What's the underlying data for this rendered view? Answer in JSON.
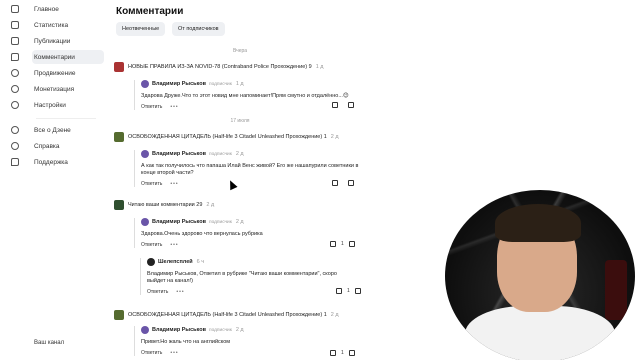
{
  "sidebar": {
    "items": [
      {
        "label": "Главное",
        "icon": "home-icon"
      },
      {
        "label": "Статистика",
        "icon": "stats-icon"
      },
      {
        "label": "Публикации",
        "icon": "publications-icon"
      },
      {
        "label": "Комментарии",
        "icon": "comments-icon",
        "active": true
      },
      {
        "label": "Продвижение",
        "icon": "promotion-icon"
      },
      {
        "label": "Монетизация",
        "icon": "money-icon"
      },
      {
        "label": "Настройки",
        "icon": "settings-icon"
      },
      {
        "label": "Все о Дзене",
        "icon": "info-icon"
      },
      {
        "label": "Справка",
        "icon": "help-icon"
      },
      {
        "label": "Поддержка",
        "icon": "support-icon"
      }
    ],
    "footer": "Ваш канал"
  },
  "main": {
    "title": "Комментарии",
    "filters": [
      "Неотвеченные",
      "От подписчиков"
    ],
    "groups": [
      {
        "date": "Вчера",
        "video": "НОВЫЕ ПРАВИЛА ИЗ-ЗА NOVID-78 (Contraband Police Прохождение) 9",
        "time": "1 д",
        "reply": {
          "author": "Владимир Рыськов",
          "subs": "подписчик",
          "time": "1 д",
          "text": "Здарова Друже.Что то этот новид мне напоминает!Прям смутно и отдалённо...😊",
          "reply_label": "Ответить",
          "likes": ""
        }
      },
      {
        "date": "17 июля",
        "video": "ОСВОБОЖДЕННАЯ ЦИТАДЕЛЬ (Half-life 3 Citadel Unleashed Прохождение) 1",
        "time": "2 д",
        "reply": {
          "author": "Владимир Рыськов",
          "subs": "подписчик",
          "time": "2 д",
          "text": "А как так получилось что папаша Илай Венс живой? Его же нашапурили советники в конце второй части?",
          "reply_label": "Ответить",
          "likes": ""
        }
      },
      {
        "date": "",
        "video": "Читаю ваши комментарии 29",
        "time": "2 д",
        "reply": {
          "author": "Владимир Рыськов",
          "subs": "подписчик",
          "time": "2 д",
          "text": "Здарова.Очень здорово что вернулась рубрика",
          "reply_label": "Ответить",
          "likes": "1"
        },
        "nested": {
          "author": "Шелепсплей",
          "time": "6 ч",
          "text": "Владимир Рыськов, Ответил в рубрике \"Читаю ваши комментарии\", скоро выйдет на канал!)",
          "reply_label": "Ответить",
          "likes": "1"
        }
      },
      {
        "date": "",
        "video": "ОСВОБОЖДЕННАЯ ЦИТАДЕЛЬ (Half-life 3 Citadel Unleashed Прохождение) 1",
        "time": "2 д",
        "reply": {
          "author": "Владимир Рыськов",
          "subs": "подписчик",
          "time": "2 д",
          "text": "Привет.Но жаль что на английском",
          "reply_label": "Ответить",
          "likes": "1"
        }
      }
    ]
  },
  "colors": {
    "active_bg": "#eef0f3",
    "text": "#222222",
    "muted": "#999999"
  }
}
